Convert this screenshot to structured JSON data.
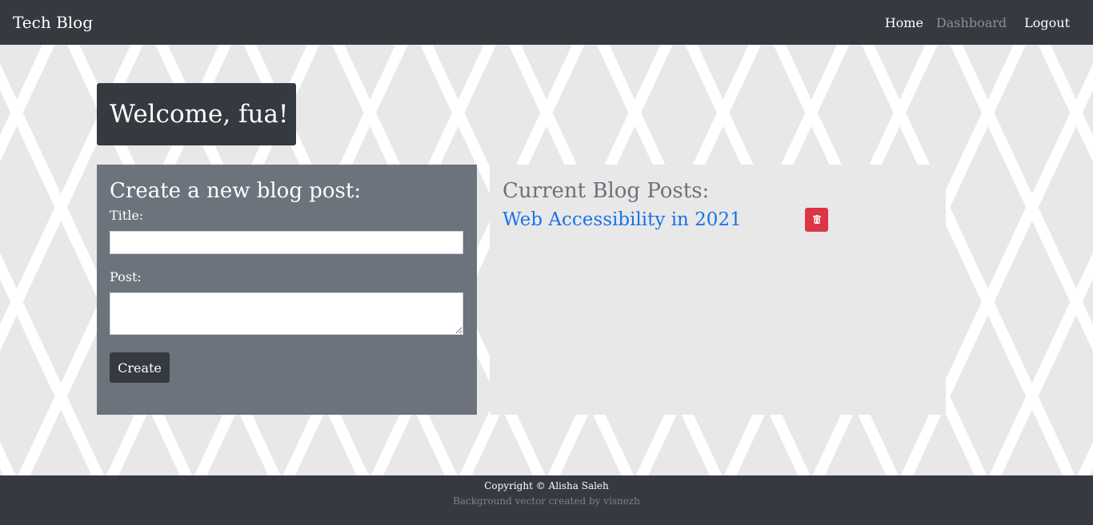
{
  "navbar": {
    "brand": "Tech Blog",
    "links": [
      {
        "label": "Home"
      },
      {
        "label": "Dashboard"
      },
      {
        "label": "Logout"
      }
    ]
  },
  "welcome": {
    "text": "Welcome, fua!"
  },
  "create_form": {
    "heading": "Create a new blog post:",
    "title_label": "Title:",
    "title_value": "",
    "post_label": "Post:",
    "post_value": "",
    "submit_label": "Create"
  },
  "posts": {
    "heading": "Current Blog Posts:",
    "items": [
      {
        "title": "Web Accessibility in 2021",
        "delete_icon": "trash-icon"
      }
    ]
  },
  "footer": {
    "copyright": "Copyright © Alisha Saleh",
    "credit": "Background vector created by visnezh"
  },
  "colors": {
    "nav_bg": "#343a40",
    "panel_bg": "#6c737c",
    "link": "#1a73e8",
    "danger": "#dc3545"
  }
}
